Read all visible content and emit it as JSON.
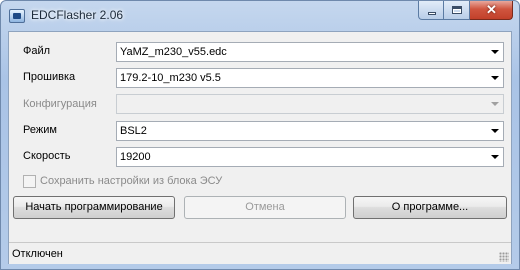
{
  "window": {
    "title": "EDCFlasher 2.06",
    "close_glyph": "✕"
  },
  "form": {
    "file": {
      "label": "Файл",
      "value": "YaMZ_m230_v55.edc"
    },
    "firmware": {
      "label": "Прошивка",
      "value": "179.2-10_m230 v5.5"
    },
    "configuration": {
      "label": "Конфигурация",
      "value": ""
    },
    "mode": {
      "label": "Режим",
      "value": "BSL2"
    },
    "speed": {
      "label": "Скорость",
      "value": "19200"
    },
    "save_settings": {
      "label": "Сохранить настройки из блока ЭСУ",
      "checked": false
    }
  },
  "buttons": {
    "start": "Начать программирование",
    "cancel": "Отмена",
    "about": "О программе..."
  },
  "status": {
    "text": "Отключен"
  },
  "icons": [
    "app-icon",
    "minimize-icon",
    "maximize-icon",
    "close-icon",
    "chevron-down-icon",
    "resize-grip-icon"
  ]
}
